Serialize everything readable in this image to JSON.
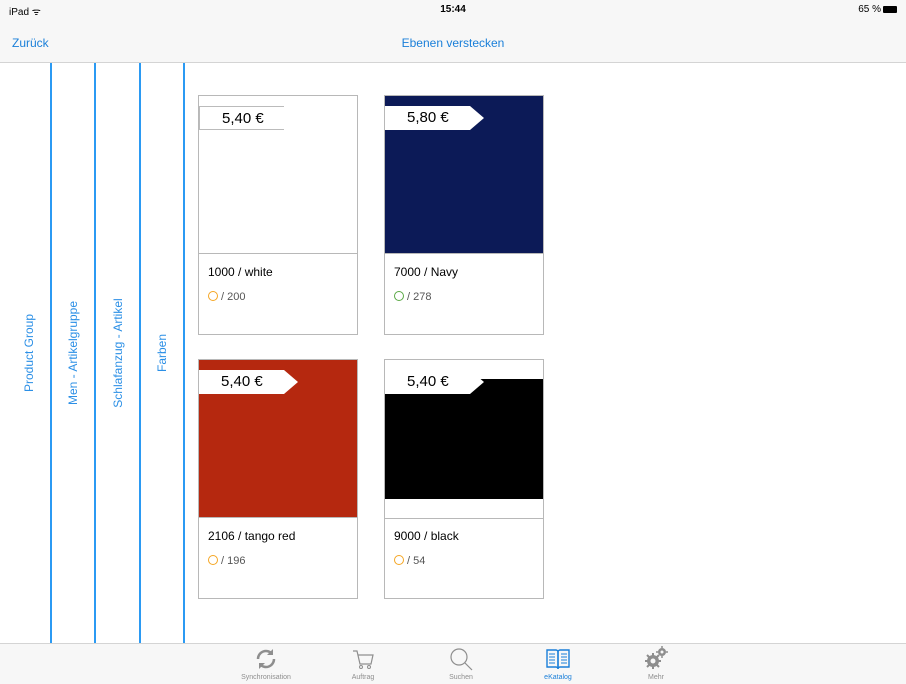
{
  "status": {
    "device": "iPad",
    "time": "15:44",
    "battery": "65 %"
  },
  "nav": {
    "back": "Zurück",
    "title": "Ebenen verstecken"
  },
  "columns": [
    "Product Group",
    "Men - Artikelgruppe",
    "Schlafanzug - Artikel",
    "Farben"
  ],
  "products": [
    {
      "price": "5,40 €",
      "name": "1000 / white",
      "stock": "/ 200",
      "color": "#ffffff",
      "status": "orange"
    },
    {
      "price": "5,80 €",
      "name": "7000 / Navy",
      "stock": "/ 278",
      "color": "#0c1a57",
      "status": "green"
    },
    {
      "price": "5,40 €",
      "name": "2106 / tango red",
      "stock": "/ 196",
      "color": "#b5280f",
      "status": "orange"
    },
    {
      "price": "5,40 €",
      "name": "9000 / black",
      "stock": "/ 54",
      "color": "#000000",
      "status": "orange"
    }
  ],
  "tabs": [
    {
      "label": "Synchronisation",
      "icon": "sync-icon"
    },
    {
      "label": "Auftrag",
      "icon": "cart-icon"
    },
    {
      "label": "Suchen",
      "icon": "search-icon"
    },
    {
      "label": "eKatalog",
      "icon": "book-icon"
    },
    {
      "label": "Mehr",
      "icon": "gears-icon"
    }
  ],
  "colors": {
    "accent": "#1a7fd9",
    "column_line": "#2b9af3"
  }
}
